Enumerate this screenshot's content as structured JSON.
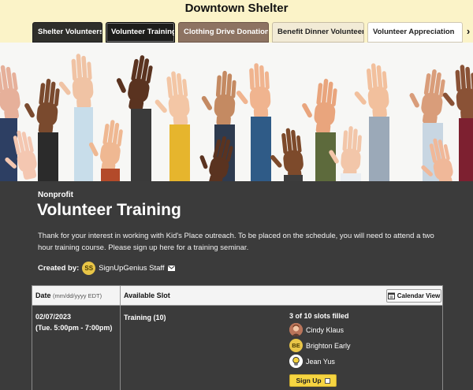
{
  "header": {
    "org_title": "Downtown Shelter",
    "tabs": [
      {
        "label": "Shelter Volunteers"
      },
      {
        "label": "Volunteer Training"
      },
      {
        "label": "Clothing Drive Donations"
      },
      {
        "label": "Benefit Dinner Volunteers"
      },
      {
        "label": "Volunteer Appreciation"
      }
    ],
    "next_arrow": "›"
  },
  "main": {
    "category": "Nonprofit",
    "title": "Volunteer Training",
    "description": "Thank for your interest in working with Kid's Place outreach.  To be placed on the schedule, you will need to attend a two hour training course.  Please sign up here for a training seminar.",
    "created_by_label": "Created by:",
    "creator": {
      "initials": "SS",
      "name": "SignUpGenius Staff"
    }
  },
  "table": {
    "date_header": "Date",
    "date_format": "(mm/dd/yyyy EDT)",
    "slot_header": "Available Slot",
    "calendar_view_label": "Calendar View",
    "rows": [
      {
        "date": "02/07/2023",
        "time": "(Tue. 5:00pm - 7:00pm)",
        "slot": "Training (10)",
        "filled": "3 of 10 slots filled",
        "signups": [
          {
            "name": "Cindy Klaus",
            "avatar": "photo"
          },
          {
            "name": "Brighton Early",
            "avatar": "BE"
          },
          {
            "name": "Jean Yus",
            "avatar": "lightbulb"
          }
        ],
        "signup_button": "Sign Up"
      }
    ]
  },
  "colors": {
    "header_bg": "#fbf3c8",
    "content_bg": "#3b3b3b",
    "accent_yellow": "#f6d541",
    "tab_active": "#1d1d1b",
    "tab_brown": "#8d7362"
  }
}
